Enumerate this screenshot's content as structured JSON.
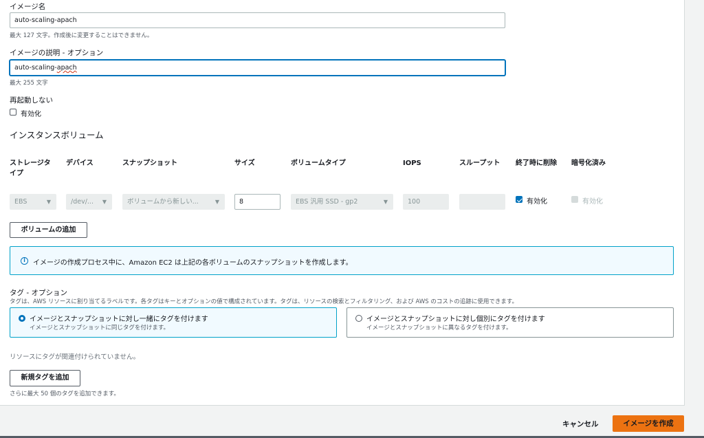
{
  "image_name": {
    "label": "イメージ名",
    "value": "auto-scaling-apach",
    "hint": "最大 127 文字。作成後に変更することはできません。"
  },
  "image_description": {
    "label": "イメージの説明 - オプション",
    "value_prefix": "auto-scaling-",
    "value_suffix": "apach",
    "hint": "最大 255 文字"
  },
  "no_reboot": {
    "label": "再起動しない",
    "checkbox_label": "有効化",
    "checked": false
  },
  "volumes": {
    "title": "インスタンスボリューム",
    "headers": {
      "storage_type": "ストレージタイプ",
      "device": "デバイス",
      "snapshot": "スナップショット",
      "size": "サイズ",
      "volume_type": "ボリュームタイプ",
      "iops": "IOPS",
      "throughput": "スループット",
      "delete_on_termination": "終了時に削除",
      "encrypted": "暗号化済み"
    },
    "row": {
      "storage_type": "EBS",
      "device": "/dev/...",
      "snapshot": "ボリュームから新しい...",
      "size": "8",
      "volume_type": "EBS 汎用 SSD - gp2",
      "iops": "100",
      "throughput": "",
      "delete_on_termination_label": "有効化",
      "encrypted_label": "有効化"
    },
    "add_button": "ボリュームの追加"
  },
  "info": {
    "icon": "info-icon",
    "message": "イメージの作成プロセス中に、Amazon EC2 は上記の各ボリュームのスナップショットを作成します。"
  },
  "tags": {
    "title": "タグ - オプション",
    "description": "タグは、AWS リソースに割り当てるラベルです。各タグはキーとオプションの値で構成されています。タグは、リソースの検索とフィルタリング、および AWS のコストの追跡に使用できます。",
    "options": [
      {
        "title": "イメージとスナップショットに対し一緒にタグを付けます",
        "desc": "イメージとスナップショットに同じタグを付けます。",
        "selected": true
      },
      {
        "title": "イメージとスナップショットに対し個別にタグを付けます",
        "desc": "イメージとスナップショットに異なるタグを付けます。",
        "selected": false
      }
    ],
    "empty_message": "リソースにタグが関連付けられていません。",
    "add_button": "新規タグを追加",
    "add_hint": "さらに最大 50 個のタグを追加できます。"
  },
  "footer": {
    "cancel": "キャンセル",
    "create": "イメージを作成"
  },
  "colors": {
    "primary": "#ec7211",
    "link": "#0073bb",
    "info_border": "#00a1c9",
    "info_bg": "#f1faff"
  }
}
